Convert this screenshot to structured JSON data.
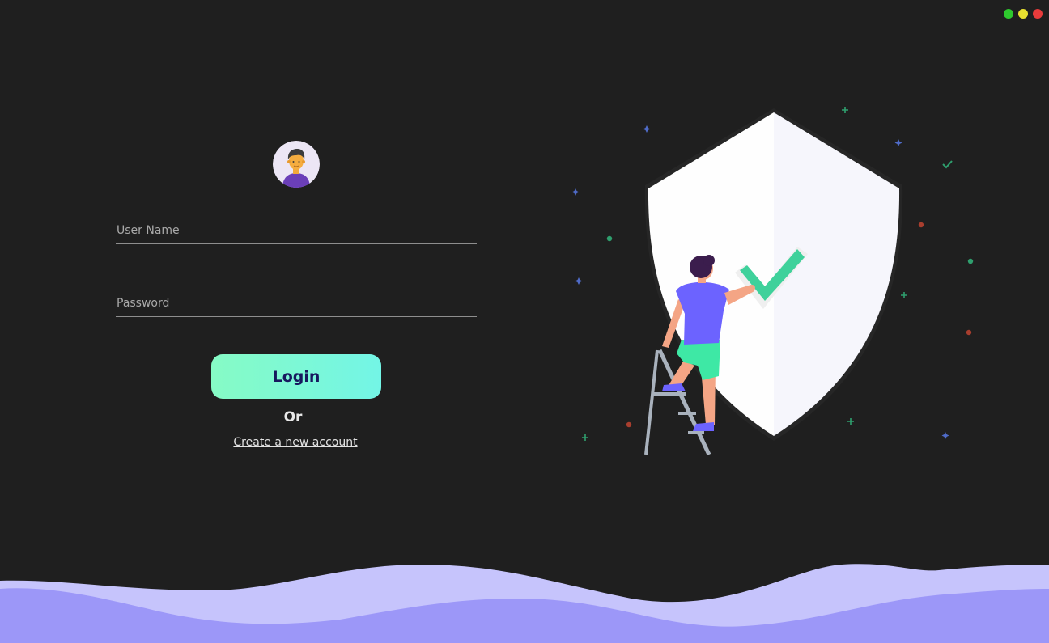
{
  "window": {
    "controls": [
      {
        "name": "minimize",
        "color": "#2ec92e"
      },
      {
        "name": "maximize",
        "color": "#e8e030"
      },
      {
        "name": "close",
        "color": "#e83b3b"
      }
    ]
  },
  "login": {
    "username_placeholder": "User Name",
    "password_placeholder": "Password",
    "username_value": "",
    "password_value": "",
    "login_label": "Login",
    "or_label": "Or",
    "create_account_label": "Create a new account"
  },
  "colors": {
    "background": "#1f1f1f",
    "login_gradient_start": "#86fbc5",
    "login_gradient_end": "#73f5e6",
    "login_text": "#17185e",
    "accent_purple": "#6c63ff",
    "wave_light": "#c6c4fc",
    "wave_dark": "#9c97f8",
    "check_green": "#34d399"
  },
  "icons": {
    "avatar": "user-avatar-icon",
    "shield": "shield-illustration",
    "check": "checkmark-icon"
  }
}
